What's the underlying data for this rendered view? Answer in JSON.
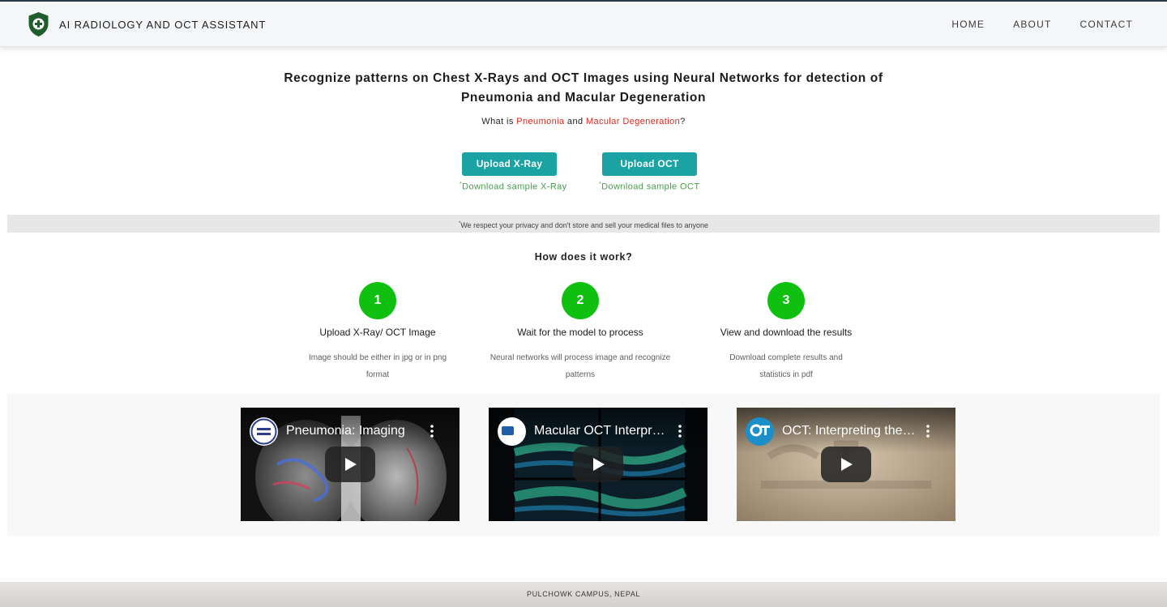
{
  "app": {
    "title": "AI RADIOLOGY AND OCT ASSISTANT",
    "logo_icon": "shield-plus-icon",
    "accent": "#1ba3a3"
  },
  "nav": {
    "items": [
      "HOME",
      "ABOUT",
      "CONTACT"
    ]
  },
  "hero": {
    "title_line1": "Recognize patterns on Chest X-Rays and OCT Images using Neural Networks for detection of",
    "title_line2": "Pneumonia and Macular Degeneration",
    "what_is_prefix": "What is ",
    "link_pneumonia": "Pneumonia",
    "what_is_and": " and ",
    "link_macular": "Macular Degeneration",
    "what_is_suffix": "?"
  },
  "upload": {
    "xray_button": "Upload X-Ray",
    "oct_button": "Upload OCT",
    "asterisk": "*",
    "xray_sample": "Download sample X-Ray",
    "oct_sample": "Download sample OCT"
  },
  "privacy": {
    "asterisk": "*",
    "text": "We respect your privacy and don't store and sell your medical files to anyone"
  },
  "how": {
    "title": "How does it work?",
    "steps": [
      {
        "number": "1",
        "title": "Upload X-Ray/ OCT Image",
        "desc": "Image should be either in jpg or in png format"
      },
      {
        "number": "2",
        "title": "Wait for the model to process",
        "desc": "Neural networks will process image and recognize patterns"
      },
      {
        "number": "3",
        "title": "View and download the results",
        "desc": "Download complete results and statistics in pdf"
      }
    ]
  },
  "videos": [
    {
      "title": "Pneumonia: Imaging",
      "channel_icon": "casemed-minute-logo-icon"
    },
    {
      "title": "Macular OCT Interpr…",
      "channel_icon": "od-logo-icon"
    },
    {
      "title": "OCT: Interpreting the…",
      "channel_icon": "ot-logo-icon"
    }
  ],
  "footer": {
    "text": "PULCHOWK CAMPUS, NEPAL"
  }
}
